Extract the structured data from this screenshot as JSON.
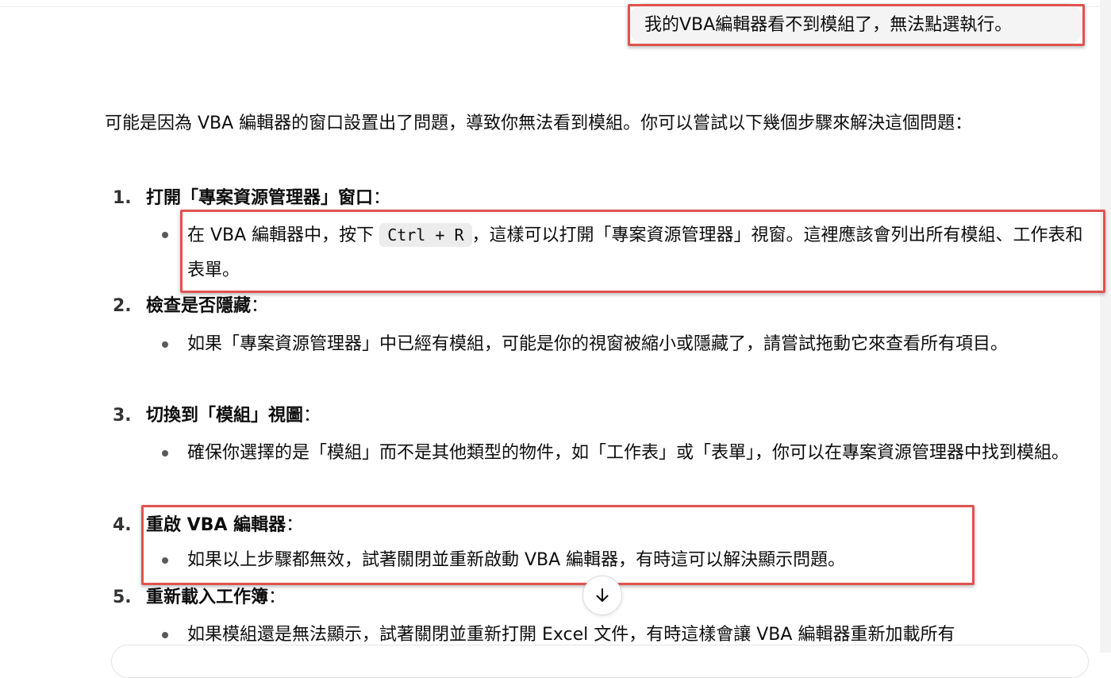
{
  "user_message": "我的VBA編輯器看不到模組了，無法點選執行。",
  "intro": "可能是因為 VBA 編輯器的窗口設置出了問題，導致你無法看到模組。你可以嘗試以下幾個步驟來解決這個問題：",
  "steps": [
    {
      "num": "1.",
      "title": "打開「專案資源管理器」窗口",
      "colon": "：",
      "bullet_pre": "在 VBA 編輯器中，按下 ",
      "bullet_code": "Ctrl + R",
      "bullet_post": "，這樣可以打開「專案資源管理器」視窗。這裡應該會列出所有模組、工作表和表單。"
    },
    {
      "num": "2.",
      "title": "檢查是否隱藏",
      "colon": "：",
      "bullet": "如果「專案資源管理器」中已經有模組，可能是你的視窗被縮小或隱藏了，請嘗試拖動它來查看所有項目。"
    },
    {
      "num": "3.",
      "title": "切換到「模組」視圖",
      "colon": "：",
      "bullet": "確保你選擇的是「模組」而不是其他類型的物件，如「工作表」或「表單」，你可以在專案資源管理器中找到模組。"
    },
    {
      "num": "4.",
      "title": "重啟 VBA 編輯器",
      "colon": "：",
      "bullet": "如果以上步驟都無效，試著關閉並重新啟動 VBA 編輯器，有時這可以解決顯示問題。"
    },
    {
      "num": "5.",
      "title": "重新載入工作簿",
      "colon": "：",
      "bullet": "如果模組還是無法顯示，試著關閉並重新打開 Excel 文件，有時這樣會讓 VBA 編輯器重新加載所有"
    }
  ],
  "scroll_down_icon": "arrow-down-icon",
  "colors": {
    "highlight": "#e0534f",
    "bubble": "#f4f4f4",
    "code_bg": "#ececec"
  }
}
